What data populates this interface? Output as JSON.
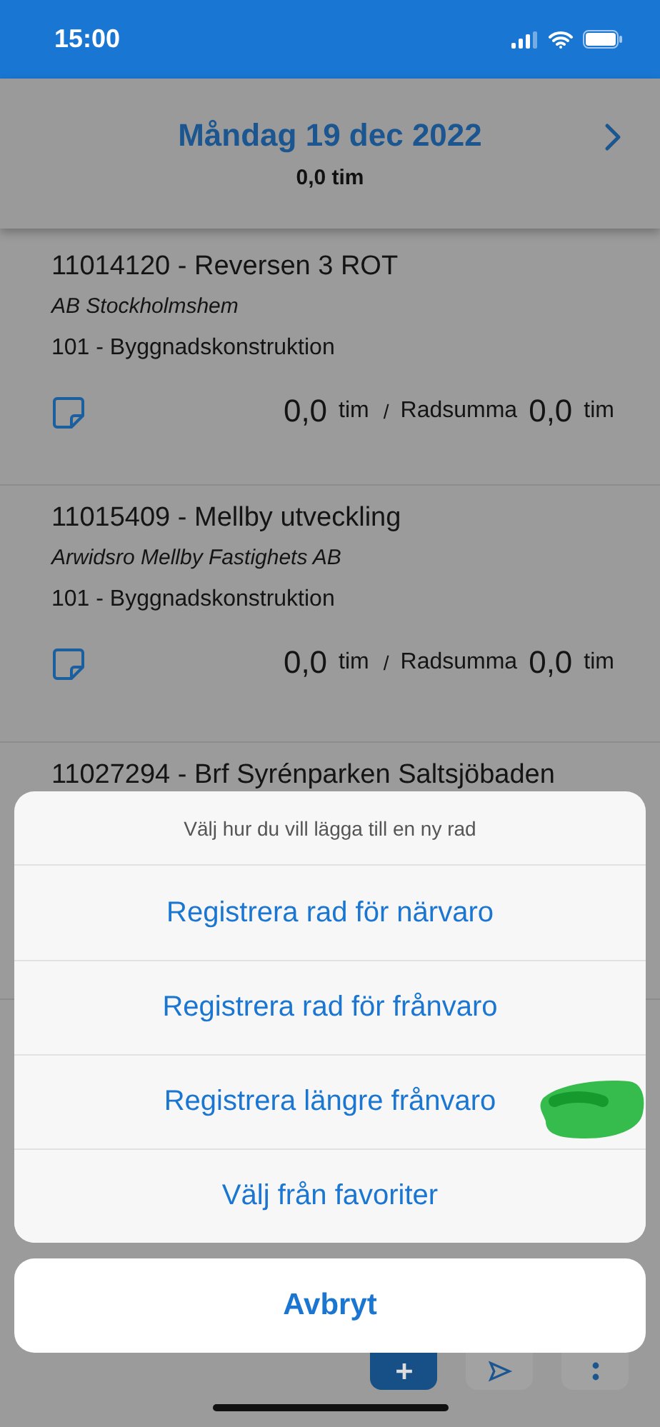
{
  "status_bar": {
    "time": "15:00"
  },
  "header": {
    "date": "Måndag 19 dec 2022",
    "total": "0,0 tim"
  },
  "rows": [
    {
      "project": "11014120 - Reversen 3 ROT",
      "customer": "AB Stockholmshem",
      "activity": "101 - Byggnadskonstruktion",
      "hours": "0,0",
      "hours_unit": "tim",
      "separator": "/",
      "sum_label": "Radsumma",
      "sum": "0,0",
      "sum_unit": "tim"
    },
    {
      "project": "11015409 - Mellby utveckling",
      "customer": "Arwidsro Mellby Fastighets AB",
      "activity": "101 - Byggnadskonstruktion",
      "hours": "0,0",
      "hours_unit": "tim",
      "separator": "/",
      "sum_label": "Radsumma",
      "sum": "0,0",
      "sum_unit": "tim"
    },
    {
      "project": "11027294 - Brf Syrénparken Saltsjöbaden"
    }
  ],
  "action_sheet": {
    "title": "Välj hur du vill lägga till en ny rad",
    "options": [
      {
        "label": "Registrera rad för närvaro",
        "marked": false
      },
      {
        "label": "Registrera rad för frånvaro",
        "marked": false
      },
      {
        "label": "Registrera längre frånvaro",
        "marked": true
      },
      {
        "label": "Välj från favoriter",
        "marked": false
      }
    ],
    "cancel": "Avbryt"
  }
}
